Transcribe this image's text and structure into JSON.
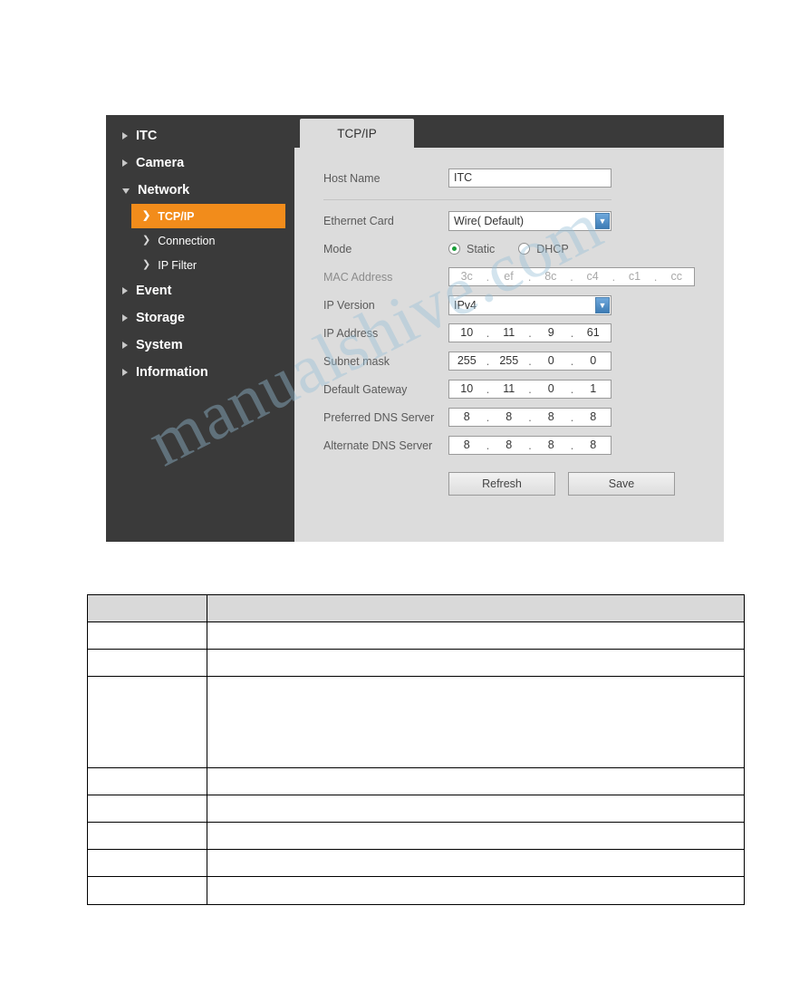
{
  "panel": {
    "sidebar": {
      "items": [
        {
          "label": "ITC",
          "state": "closed",
          "level": "top"
        },
        {
          "label": "Camera",
          "state": "closed",
          "level": "top"
        },
        {
          "label": "Network",
          "state": "open",
          "level": "top"
        },
        {
          "label": "TCP/IP",
          "level": "sub",
          "active": true
        },
        {
          "label": "Connection",
          "level": "sub",
          "active": false
        },
        {
          "label": "IP Filter",
          "level": "sub",
          "active": false
        },
        {
          "label": "Event",
          "state": "closed",
          "level": "top"
        },
        {
          "label": "Storage",
          "state": "closed",
          "level": "top"
        },
        {
          "label": "System",
          "state": "closed",
          "level": "top"
        },
        {
          "label": "Information",
          "state": "closed",
          "level": "top"
        }
      ]
    },
    "tab": {
      "label": "TCP/IP"
    },
    "form": {
      "host_name": {
        "label": "Host Name",
        "value": "ITC"
      },
      "ethernet_card": {
        "label": "Ethernet Card",
        "value": "Wire( Default)"
      },
      "mode": {
        "label": "Mode",
        "options": [
          {
            "label": "Static",
            "checked": true
          },
          {
            "label": "DHCP",
            "checked": false
          }
        ]
      },
      "mac_address": {
        "label": "MAC Address",
        "segments": [
          "3c",
          "ef",
          "8c",
          "c4",
          "c1",
          "cc"
        ]
      },
      "ip_version": {
        "label": "IP Version",
        "value": "IPv4"
      },
      "ip_address": {
        "label": "IP Address",
        "segments": [
          "10",
          "11",
          "9",
          "61"
        ]
      },
      "subnet_mask": {
        "label": "Subnet mask",
        "segments": [
          "255",
          "255",
          "0",
          "0"
        ]
      },
      "default_gateway": {
        "label": "Default Gateway",
        "segments": [
          "10",
          "11",
          "0",
          "1"
        ]
      },
      "preferred_dns": {
        "label": "Preferred DNS Server",
        "segments": [
          "8",
          "8",
          "8",
          "8"
        ]
      },
      "alternate_dns": {
        "label": "Alternate DNS Server",
        "segments": [
          "8",
          "8",
          "8",
          "8"
        ]
      },
      "buttons": {
        "refresh": "Refresh",
        "save": "Save"
      }
    }
  },
  "watermark": {
    "text": "manualshive.com"
  },
  "table": {
    "rows": [
      {
        "heights": 30,
        "header": true,
        "c1": "",
        "c2": ""
      },
      {
        "heights": 30,
        "header": false,
        "c1": "",
        "c2": ""
      },
      {
        "heights": 30,
        "header": false,
        "c1": "",
        "c2": ""
      },
      {
        "heights": 101,
        "header": false,
        "c1": "",
        "c2": ""
      },
      {
        "heights": 30,
        "header": false,
        "c1": "",
        "c2": ""
      },
      {
        "heights": 30,
        "header": false,
        "c1": "",
        "c2": ""
      },
      {
        "heights": 30,
        "header": false,
        "c1": "",
        "c2": ""
      },
      {
        "heights": 30,
        "header": false,
        "c1": "",
        "c2": ""
      },
      {
        "heights": 31,
        "header": false,
        "c1": "",
        "c2": ""
      }
    ]
  },
  "colors": {
    "accent": "#f28c1b",
    "panel_dark": "#3a3a3a",
    "content_bg": "#dcdcdc",
    "radio_green": "#1b9e3a"
  }
}
